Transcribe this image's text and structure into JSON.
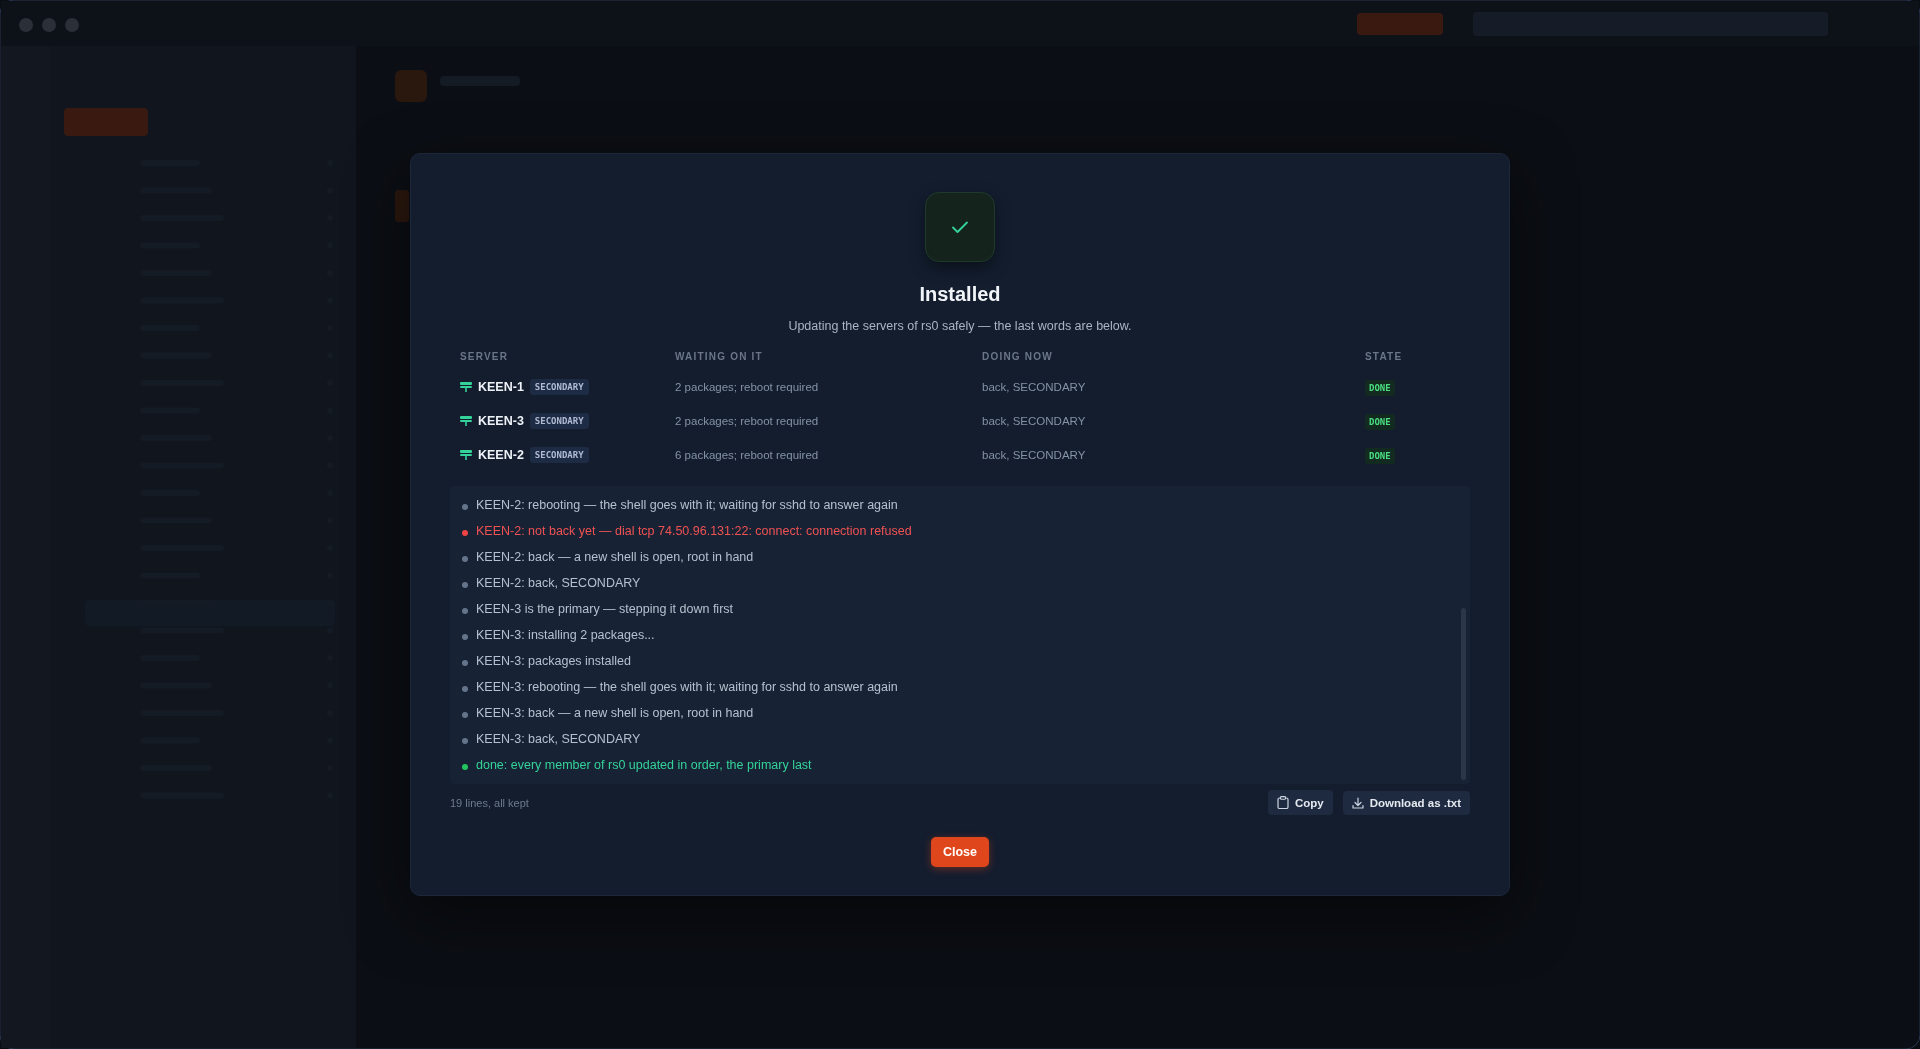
{
  "dialog": {
    "title": "Installed",
    "subtitle": "Updating the servers of rs0 safely — the last words are below.",
    "table": {
      "columns": [
        "SERVER",
        "WAITING ON IT",
        "DOING NOW",
        "STATE"
      ],
      "rows": [
        {
          "server": "KEEN-1",
          "role": "SECONDARY",
          "waiting": "2 packages; reboot required",
          "doing": "back, SECONDARY",
          "state": "DONE"
        },
        {
          "server": "KEEN-3",
          "role": "SECONDARY",
          "waiting": "2 packages; reboot required",
          "doing": "back, SECONDARY",
          "state": "DONE"
        },
        {
          "server": "KEEN-2",
          "role": "SECONDARY",
          "waiting": "6 packages; reboot required",
          "doing": "back, SECONDARY",
          "state": "DONE"
        }
      ]
    },
    "log": [
      {
        "kind": "info",
        "text": "KEEN-2: rebooting — the shell goes with it; waiting for sshd to answer again"
      },
      {
        "kind": "error",
        "text": "KEEN-2: not back yet — dial tcp 74.50.96.131:22: connect: connection refused"
      },
      {
        "kind": "info",
        "text": "KEEN-2: back — a new shell is open, root in hand"
      },
      {
        "kind": "info",
        "text": "KEEN-2: back, SECONDARY"
      },
      {
        "kind": "info",
        "text": "KEEN-3 is the primary — stepping it down first"
      },
      {
        "kind": "info",
        "text": "KEEN-3: installing 2 packages..."
      },
      {
        "kind": "info",
        "text": "KEEN-3: packages installed"
      },
      {
        "kind": "info",
        "text": "KEEN-3: rebooting — the shell goes with it; waiting for sshd to answer again"
      },
      {
        "kind": "info",
        "text": "KEEN-3: back — a new shell is open, root in hand"
      },
      {
        "kind": "info",
        "text": "KEEN-3: back, SECONDARY"
      },
      {
        "kind": "success",
        "text": "done: every member of rs0 updated in order, the primary last"
      }
    ],
    "log_summary": "19 lines, all kept",
    "buttons": {
      "copy": "Copy",
      "download": "Download as .txt",
      "close": "Close"
    }
  }
}
